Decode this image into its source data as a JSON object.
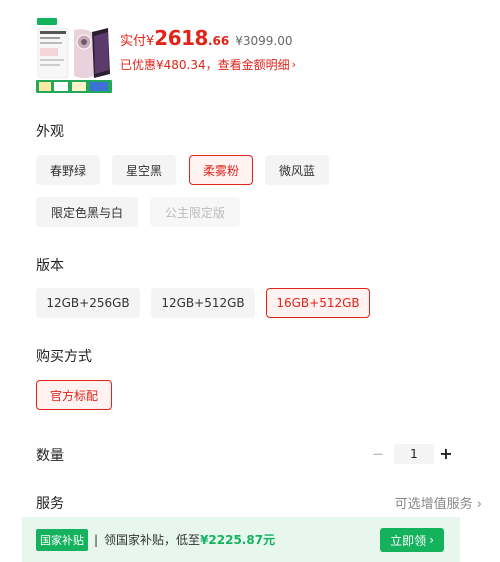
{
  "header": {
    "price_label": "实付",
    "price_currency": "¥",
    "price_integer": "2618",
    "price_decimal": ".66",
    "original_price": "¥3099.00",
    "discount_text": "已优惠¥480.34，查看金额明细",
    "discount_chevron": "›"
  },
  "appearance": {
    "title": "外观",
    "options": [
      "春野绿",
      "星空黑",
      "柔雾粉",
      "微风蓝",
      "限定色黑与白",
      "公主限定版"
    ],
    "selected": "柔雾粉",
    "disabled": "公主限定版"
  },
  "version": {
    "title": "版本",
    "options": [
      "12GB+256GB",
      "12GB+512GB",
      "16GB+512GB"
    ],
    "selected": "16GB+512GB"
  },
  "purchase": {
    "title": "购买方式",
    "options": [
      "官方标配"
    ],
    "selected": "官方标配"
  },
  "quantity": {
    "title": "数量",
    "minus": "−",
    "value": "1",
    "plus": "+"
  },
  "service": {
    "title": "服务",
    "link": "可选增值服务 ›"
  },
  "subsidy": {
    "badge": "国家补贴",
    "separator": "|",
    "text": "领国家补贴，低至",
    "amount": "¥2225.87元",
    "button": "立即领",
    "button_chevron": "›"
  },
  "colors": {
    "accent_red": "#e2231a",
    "accent_green": "#15b25e"
  }
}
